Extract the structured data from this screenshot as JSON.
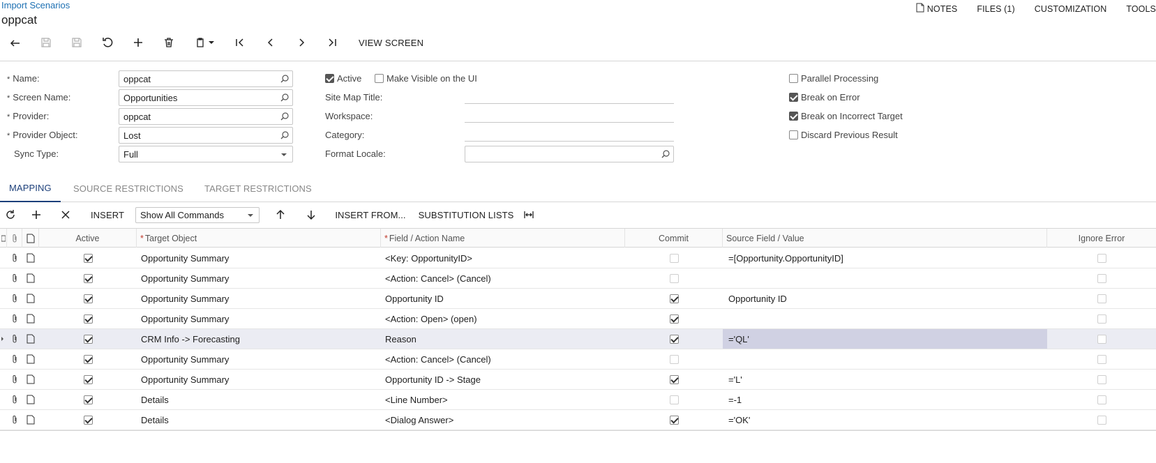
{
  "breadcrumb": "Import Scenarios",
  "page_title": "oppcat",
  "topnav": {
    "notes": "NOTES",
    "files": "FILES (1)",
    "customization": "CUSTOMIZATION",
    "tools": "TOOLS"
  },
  "toolbar": {
    "view_screen": "VIEW SCREEN"
  },
  "form": {
    "name_label": "Name:",
    "name_value": "oppcat",
    "screen_name_label": "Screen Name:",
    "screen_name_value": "Opportunities",
    "provider_label": "Provider:",
    "provider_value": "oppcat",
    "provider_object_label": "Provider Object:",
    "provider_object_value": "Lost",
    "sync_type_label": "Sync Type:",
    "sync_type_value": "Full",
    "active_label": "Active",
    "make_visible_label": "Make Visible on the UI",
    "site_map_title_label": "Site Map Title:",
    "workspace_label": "Workspace:",
    "category_label": "Category:",
    "format_locale_label": "Format Locale:",
    "parallel_processing_label": "Parallel Processing",
    "break_on_error_label": "Break on Error",
    "break_on_incorrect_target_label": "Break on Incorrect Target",
    "discard_previous_result_label": "Discard Previous Result"
  },
  "tabs": [
    "MAPPING",
    "SOURCE RESTRICTIONS",
    "TARGET RESTRICTIONS"
  ],
  "gridbar": {
    "insert": "INSERT",
    "show_commands": "Show All Commands",
    "insert_from": "INSERT FROM...",
    "substitution_lists": "SUBSTITUTION LISTS"
  },
  "grid": {
    "headers": {
      "active": "Active",
      "target_object": "Target Object",
      "field_action": "Field / Action Name",
      "commit": "Commit",
      "source_field": "Source Field / Value",
      "ignore_error": "Ignore Error"
    },
    "rows": [
      {
        "target": "Opportunity Summary",
        "field": "<Key: OpportunityID>",
        "commit": false,
        "source": "=[Opportunity.OpportunityID]"
      },
      {
        "target": "Opportunity Summary",
        "field": "<Action: Cancel> (Cancel)",
        "commit": false,
        "source": ""
      },
      {
        "target": "Opportunity Summary",
        "field": "Opportunity ID",
        "commit": true,
        "source": "Opportunity ID"
      },
      {
        "target": "Opportunity Summary",
        "field": "<Action: Open> (open)",
        "commit": true,
        "source": ""
      },
      {
        "target": "CRM Info -> Forecasting",
        "field": "Reason",
        "commit": true,
        "source": "='QL'"
      },
      {
        "target": "Opportunity Summary",
        "field": "<Action: Cancel> (Cancel)",
        "commit": false,
        "source": ""
      },
      {
        "target": "Opportunity Summary",
        "field": "Opportunity ID -> Stage",
        "commit": true,
        "source": "='L'"
      },
      {
        "target": "Details",
        "field": "<Line Number>",
        "commit": false,
        "source": "=-1"
      },
      {
        "target": "Details",
        "field": "<Dialog Answer>",
        "commit": true,
        "source": "='OK'"
      }
    ]
  }
}
